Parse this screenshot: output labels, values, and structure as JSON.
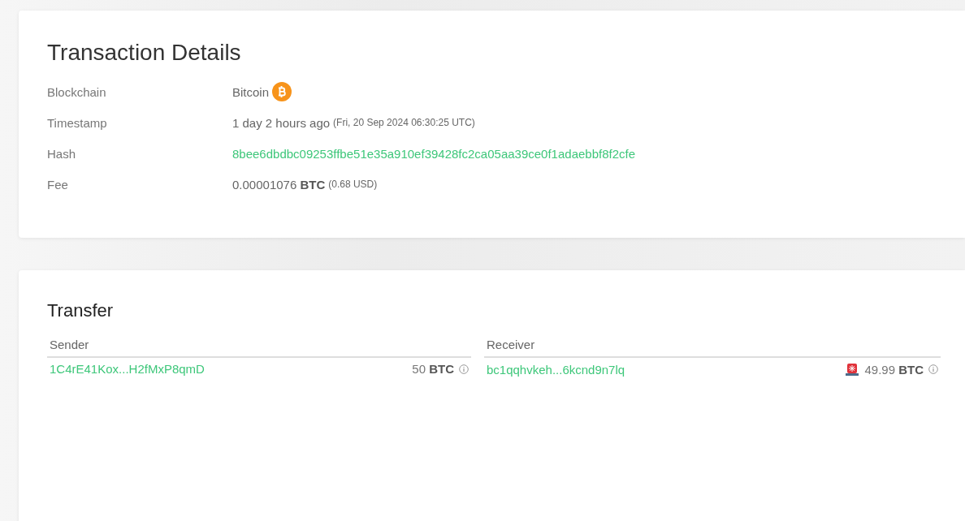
{
  "details": {
    "title": "Transaction Details",
    "rows": [
      {
        "kind": "chain",
        "label": "Blockchain",
        "value": "Bitcoin"
      },
      {
        "kind": "time",
        "label": "Timestamp",
        "value": "1 day 2 hours ago",
        "note": "(Fri, 20 Sep 2024 06:30:25 UTC)"
      },
      {
        "kind": "link",
        "label": "Hash",
        "value": "8bee6dbdbc09253ffbe51e35a910ef39428fc2ca05aa39ce0f1adaebbf8f2cfe"
      },
      {
        "kind": "fee",
        "label": "Fee",
        "value": "0.00001076 **BTC**",
        "note": "(0.68 USD)"
      }
    ]
  },
  "transfer": {
    "title": "Transfer",
    "columns": [
      {
        "heading": "Sender",
        "address": "1C4rE41Kox...H2fMxP8qmD",
        "amount": "50 **BTC**",
        "alert": false
      },
      {
        "heading": "Receiver",
        "address": "bc1qqhvkeh...6kcnd9n7lq",
        "amount": "49.99 **BTC**",
        "alert": true
      }
    ]
  }
}
